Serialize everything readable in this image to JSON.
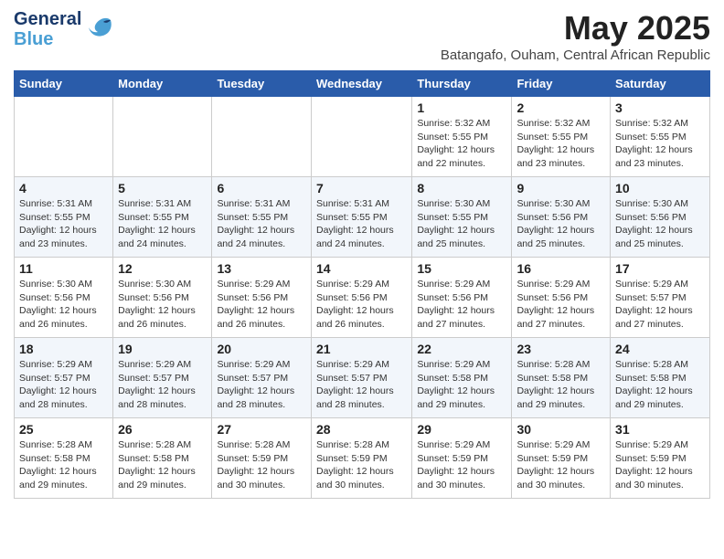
{
  "header": {
    "logo_line1": "General",
    "logo_line2": "Blue",
    "month_year": "May 2025",
    "location": "Batangafo, Ouham, Central African Republic"
  },
  "weekdays": [
    "Sunday",
    "Monday",
    "Tuesday",
    "Wednesday",
    "Thursday",
    "Friday",
    "Saturday"
  ],
  "weeks": [
    [
      {
        "day": "",
        "info": ""
      },
      {
        "day": "",
        "info": ""
      },
      {
        "day": "",
        "info": ""
      },
      {
        "day": "",
        "info": ""
      },
      {
        "day": "1",
        "info": "Sunrise: 5:32 AM\nSunset: 5:55 PM\nDaylight: 12 hours\nand 22 minutes."
      },
      {
        "day": "2",
        "info": "Sunrise: 5:32 AM\nSunset: 5:55 PM\nDaylight: 12 hours\nand 23 minutes."
      },
      {
        "day": "3",
        "info": "Sunrise: 5:32 AM\nSunset: 5:55 PM\nDaylight: 12 hours\nand 23 minutes."
      }
    ],
    [
      {
        "day": "4",
        "info": "Sunrise: 5:31 AM\nSunset: 5:55 PM\nDaylight: 12 hours\nand 23 minutes."
      },
      {
        "day": "5",
        "info": "Sunrise: 5:31 AM\nSunset: 5:55 PM\nDaylight: 12 hours\nand 24 minutes."
      },
      {
        "day": "6",
        "info": "Sunrise: 5:31 AM\nSunset: 5:55 PM\nDaylight: 12 hours\nand 24 minutes."
      },
      {
        "day": "7",
        "info": "Sunrise: 5:31 AM\nSunset: 5:55 PM\nDaylight: 12 hours\nand 24 minutes."
      },
      {
        "day": "8",
        "info": "Sunrise: 5:30 AM\nSunset: 5:55 PM\nDaylight: 12 hours\nand 25 minutes."
      },
      {
        "day": "9",
        "info": "Sunrise: 5:30 AM\nSunset: 5:56 PM\nDaylight: 12 hours\nand 25 minutes."
      },
      {
        "day": "10",
        "info": "Sunrise: 5:30 AM\nSunset: 5:56 PM\nDaylight: 12 hours\nand 25 minutes."
      }
    ],
    [
      {
        "day": "11",
        "info": "Sunrise: 5:30 AM\nSunset: 5:56 PM\nDaylight: 12 hours\nand 26 minutes."
      },
      {
        "day": "12",
        "info": "Sunrise: 5:30 AM\nSunset: 5:56 PM\nDaylight: 12 hours\nand 26 minutes."
      },
      {
        "day": "13",
        "info": "Sunrise: 5:29 AM\nSunset: 5:56 PM\nDaylight: 12 hours\nand 26 minutes."
      },
      {
        "day": "14",
        "info": "Sunrise: 5:29 AM\nSunset: 5:56 PM\nDaylight: 12 hours\nand 26 minutes."
      },
      {
        "day": "15",
        "info": "Sunrise: 5:29 AM\nSunset: 5:56 PM\nDaylight: 12 hours\nand 27 minutes."
      },
      {
        "day": "16",
        "info": "Sunrise: 5:29 AM\nSunset: 5:56 PM\nDaylight: 12 hours\nand 27 minutes."
      },
      {
        "day": "17",
        "info": "Sunrise: 5:29 AM\nSunset: 5:57 PM\nDaylight: 12 hours\nand 27 minutes."
      }
    ],
    [
      {
        "day": "18",
        "info": "Sunrise: 5:29 AM\nSunset: 5:57 PM\nDaylight: 12 hours\nand 28 minutes."
      },
      {
        "day": "19",
        "info": "Sunrise: 5:29 AM\nSunset: 5:57 PM\nDaylight: 12 hours\nand 28 minutes."
      },
      {
        "day": "20",
        "info": "Sunrise: 5:29 AM\nSunset: 5:57 PM\nDaylight: 12 hours\nand 28 minutes."
      },
      {
        "day": "21",
        "info": "Sunrise: 5:29 AM\nSunset: 5:57 PM\nDaylight: 12 hours\nand 28 minutes."
      },
      {
        "day": "22",
        "info": "Sunrise: 5:29 AM\nSunset: 5:58 PM\nDaylight: 12 hours\nand 29 minutes."
      },
      {
        "day": "23",
        "info": "Sunrise: 5:28 AM\nSunset: 5:58 PM\nDaylight: 12 hours\nand 29 minutes."
      },
      {
        "day": "24",
        "info": "Sunrise: 5:28 AM\nSunset: 5:58 PM\nDaylight: 12 hours\nand 29 minutes."
      }
    ],
    [
      {
        "day": "25",
        "info": "Sunrise: 5:28 AM\nSunset: 5:58 PM\nDaylight: 12 hours\nand 29 minutes."
      },
      {
        "day": "26",
        "info": "Sunrise: 5:28 AM\nSunset: 5:58 PM\nDaylight: 12 hours\nand 29 minutes."
      },
      {
        "day": "27",
        "info": "Sunrise: 5:28 AM\nSunset: 5:59 PM\nDaylight: 12 hours\nand 30 minutes."
      },
      {
        "day": "28",
        "info": "Sunrise: 5:28 AM\nSunset: 5:59 PM\nDaylight: 12 hours\nand 30 minutes."
      },
      {
        "day": "29",
        "info": "Sunrise: 5:29 AM\nSunset: 5:59 PM\nDaylight: 12 hours\nand 30 minutes."
      },
      {
        "day": "30",
        "info": "Sunrise: 5:29 AM\nSunset: 5:59 PM\nDaylight: 12 hours\nand 30 minutes."
      },
      {
        "day": "31",
        "info": "Sunrise: 5:29 AM\nSunset: 5:59 PM\nDaylight: 12 hours\nand 30 minutes."
      }
    ]
  ]
}
